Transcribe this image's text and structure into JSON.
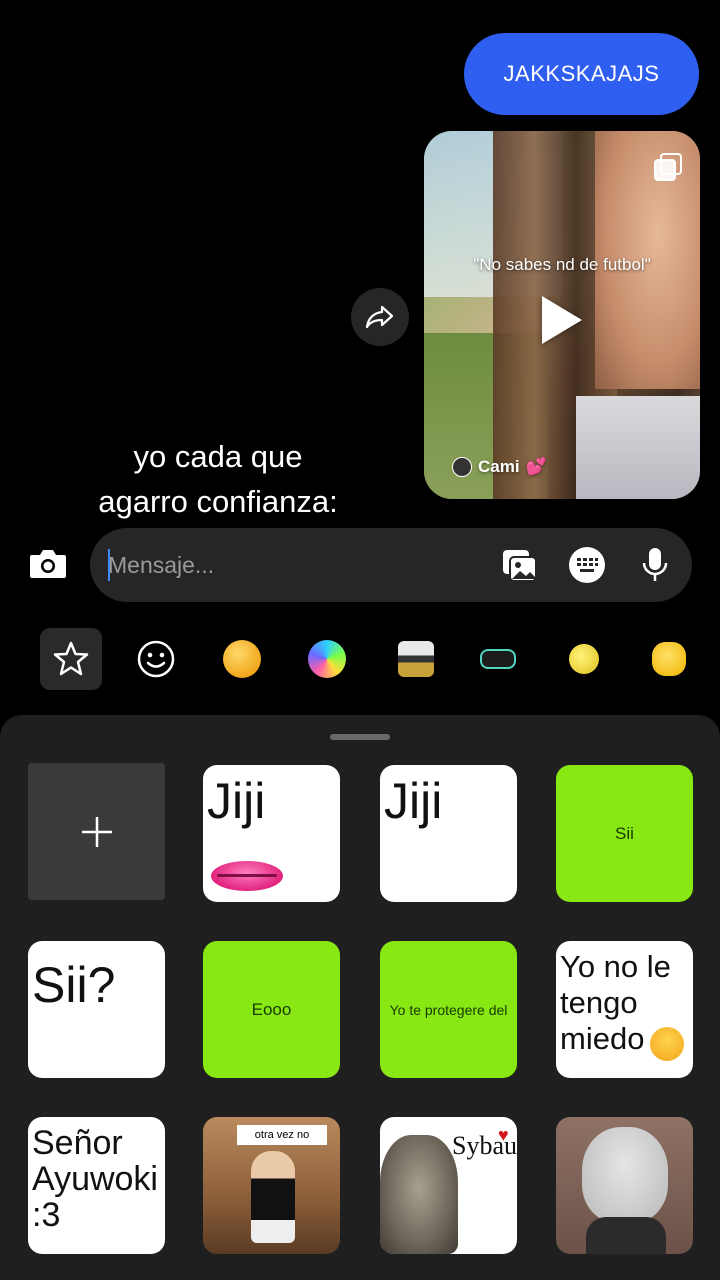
{
  "chat": {
    "sent_message": "JAKKSKAJAJS",
    "reel": {
      "caption": "\"No sabes nd de futbol\"",
      "username": "Cami",
      "user_suffix": "💕"
    }
  },
  "overlay": {
    "line1": "yo cada que",
    "line2": "agarro confianza:"
  },
  "composer": {
    "placeholder": "Mensaje..."
  },
  "icons": {
    "camera": "camera-icon",
    "gallery": "gallery-icon",
    "keyboard": "keyboard-icon",
    "mic": "microphone-icon",
    "share": "share-icon",
    "favorites": "star-icon",
    "emoji": "smiley-icon"
  },
  "stickers": [
    {
      "label": "Jiji"
    },
    {
      "label": "Jiji"
    },
    {
      "label": "Sii"
    },
    {
      "label": "Sii?"
    },
    {
      "label": "Eooo"
    },
    {
      "label": "Yo te protegere del"
    },
    {
      "label": "Yo no le tengo miedo"
    },
    {
      "label": "Señor Ayuwoki :3"
    },
    {
      "label": "otra vez no"
    },
    {
      "label": "Sybau"
    },
    {
      "label": ""
    }
  ],
  "colors": {
    "accent": "#2f5ff0",
    "sticker_green": "#87e814",
    "tray_bg": "#1f1f1f",
    "composer_bg": "#262626"
  }
}
